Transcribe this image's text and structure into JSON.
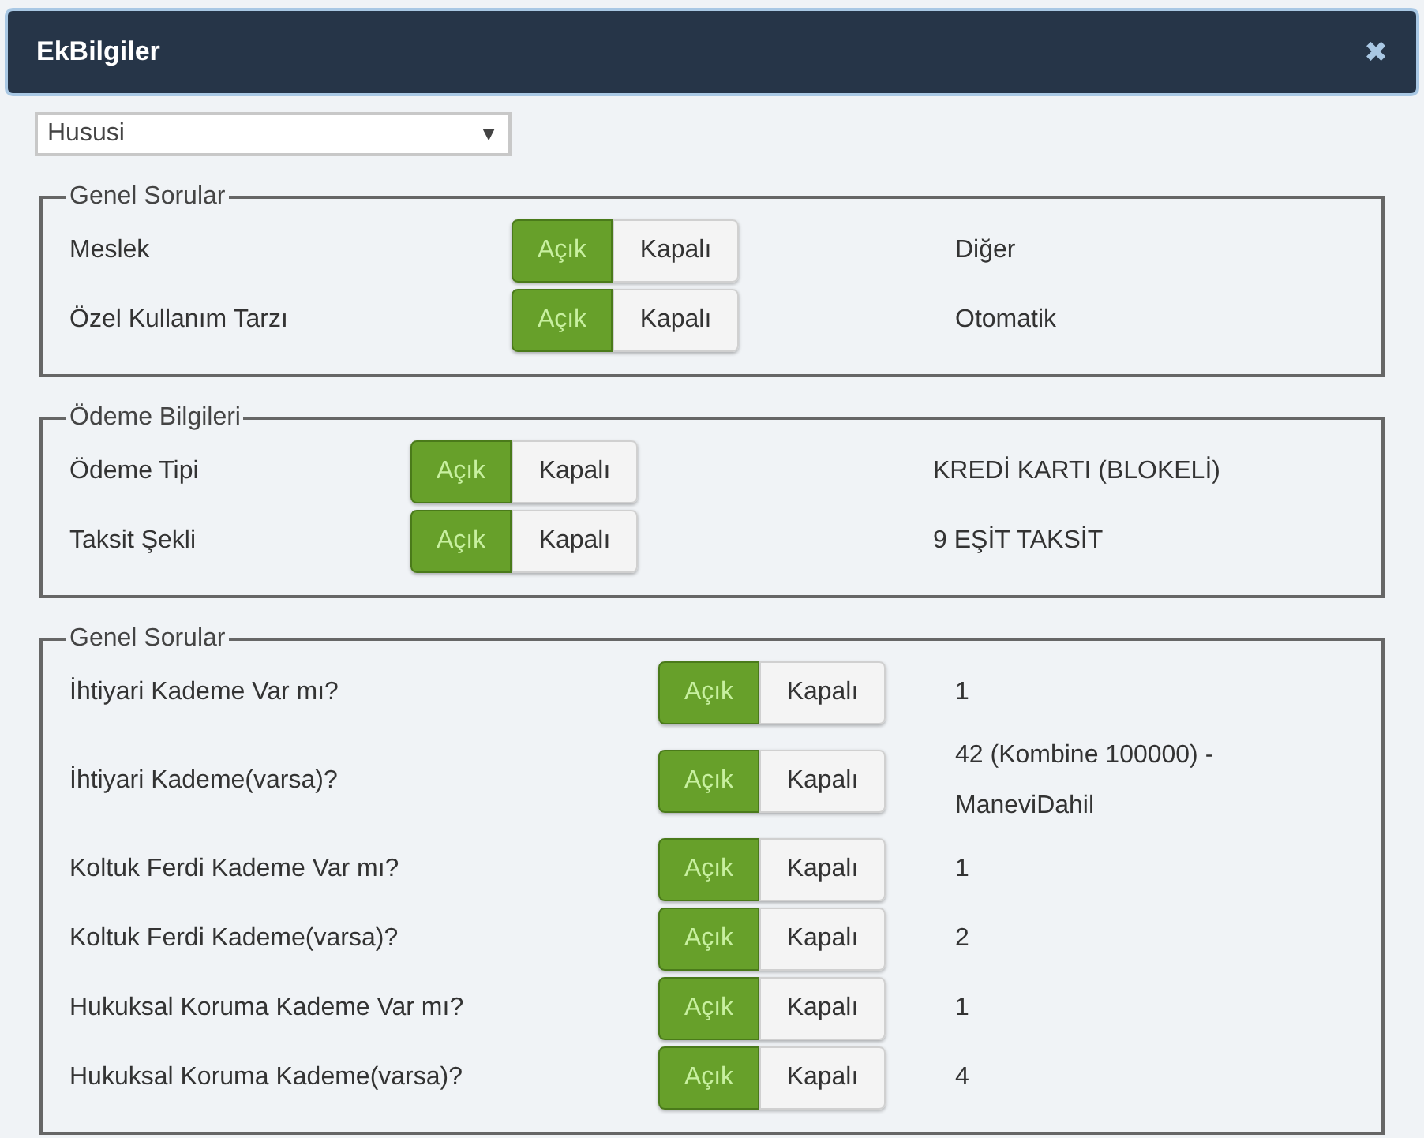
{
  "dialog": {
    "title": "EkBilgiler",
    "close": "✖"
  },
  "dropdown": {
    "value": "Hususi",
    "caret": "▼"
  },
  "sections": [
    {
      "legend": "Genel Sorular",
      "rows": [
        {
          "label": "Meslek",
          "options": [
            {
              "label": "Açık",
              "selected": true
            },
            {
              "label": "Kapalı",
              "selected": false
            }
          ],
          "value": "Diğer"
        },
        {
          "label": "Özel Kullanım Tarzı",
          "options": [
            {
              "label": "Açık",
              "selected": true
            },
            {
              "label": "Kapalı",
              "selected": false
            }
          ],
          "value": "Otomatik"
        }
      ]
    },
    {
      "legend": "Ödeme Bilgileri",
      "rows": [
        {
          "label": "Ödeme Tipi",
          "options": [
            {
              "label": "Açık",
              "selected": true
            },
            {
              "label": "Kapalı",
              "selected": false
            }
          ],
          "value": "KREDİ KARTI (BLOKELİ)"
        },
        {
          "label": "Taksit Şekli",
          "options": [
            {
              "label": "Açık",
              "selected": true
            },
            {
              "label": "Kapalı",
              "selected": false
            }
          ],
          "value": "9 EŞİT TAKSİT"
        }
      ]
    },
    {
      "legend": "Genel Sorular",
      "rows": [
        {
          "label": "İhtiyari Kademe Var mı?",
          "options": [
            {
              "label": "Açık",
              "selected": true
            },
            {
              "label": "Kapalı",
              "selected": false
            }
          ],
          "value": "1"
        },
        {
          "label": "İhtiyari Kademe(varsa)?",
          "options": [
            {
              "label": "Açık",
              "selected": true
            },
            {
              "label": "Kapalı",
              "selected": false
            }
          ],
          "value": "42 (Kombine 100000) - ManeviDahil"
        },
        {
          "label": "Koltuk Ferdi Kademe Var mı?",
          "options": [
            {
              "label": "Açık",
              "selected": true
            },
            {
              "label": "Kapalı",
              "selected": false
            }
          ],
          "value": "1"
        },
        {
          "label": "Koltuk Ferdi Kademe(varsa)?",
          "options": [
            {
              "label": "Açık",
              "selected": true
            },
            {
              "label": "Kapalı",
              "selected": false
            }
          ],
          "value": "2"
        },
        {
          "label": "Hukuksal Koruma Kademe Var mı?",
          "options": [
            {
              "label": "Açık",
              "selected": true
            },
            {
              "label": "Kapalı",
              "selected": false
            }
          ],
          "value": "1"
        },
        {
          "label": "Hukuksal Koruma Kademe(varsa)?",
          "options": [
            {
              "label": "Açık",
              "selected": true
            },
            {
              "label": "Kapalı",
              "selected": false
            }
          ],
          "value": "4"
        }
      ]
    }
  ]
}
